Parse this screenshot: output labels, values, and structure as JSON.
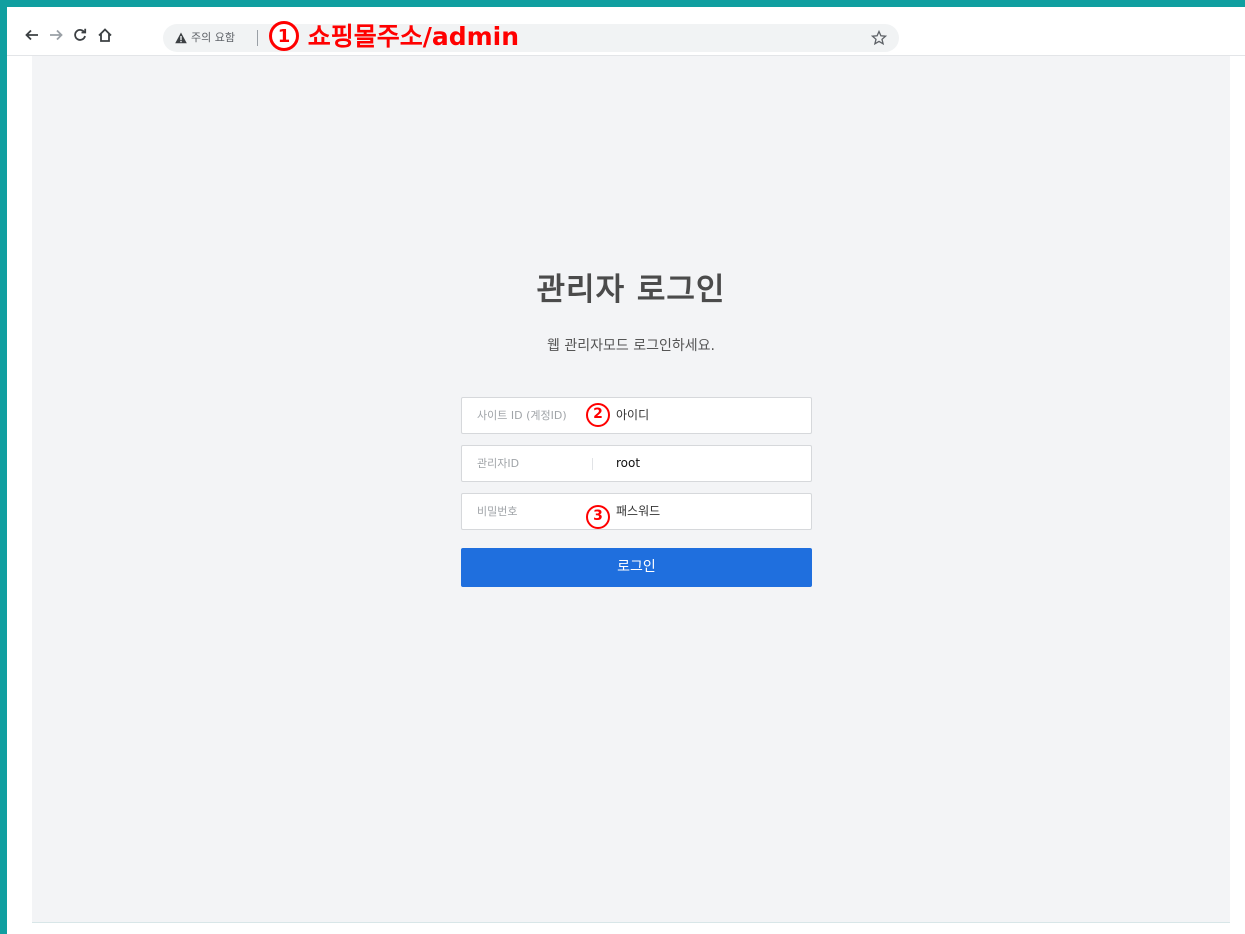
{
  "browser": {
    "security_label": "주의 요함",
    "url_annotation_number": "1",
    "url_annotation_text": "쇼핑몰주소/admin",
    "icons": {
      "back": "back-arrow-icon",
      "forward": "forward-arrow-icon",
      "reload": "reload-icon",
      "home": "home-icon",
      "warning": "warning-triangle-icon",
      "bookmark": "star-icon"
    }
  },
  "login": {
    "title": "관리자 로그인",
    "subtitle": "웹 관리자모드 로그인하세요.",
    "fields": [
      {
        "label": "사이트 ID (계정ID)",
        "annotation": "2",
        "value": "아이디"
      },
      {
        "label": "관리자ID",
        "annotation": "",
        "value": "root"
      },
      {
        "label": "비밀번호",
        "annotation": "3",
        "value": "패스워드"
      }
    ],
    "button_label": "로그인"
  },
  "colors": {
    "frame": "#109fa0",
    "annotation": "#ff0000",
    "button": "#1f6fde",
    "content_bg": "#f3f4f6"
  }
}
